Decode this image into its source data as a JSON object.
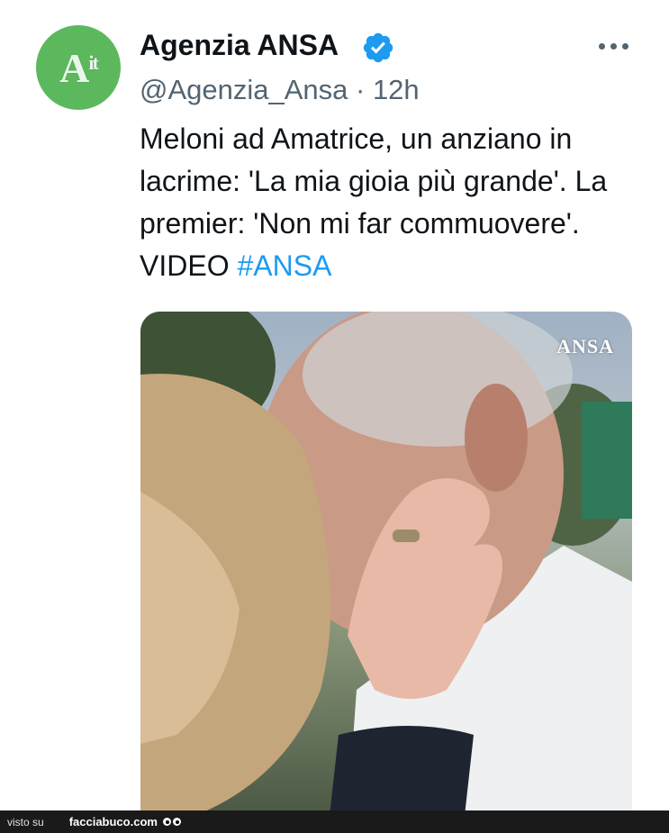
{
  "tweet": {
    "avatar": {
      "icon": "ansa-it-logo",
      "text": "A",
      "sub": "it",
      "color": "#5cb85c"
    },
    "author_name": "Agenzia ANSA",
    "verified_icon": "verified-badge-icon",
    "handle_time": "@Agenzia_Ansa · 12h",
    "text_plain": "Meloni ad Amatrice, un anziano in lacrime: 'La mia gioia più grande'. La premier: 'Non mi far commuovere'. VIDEO ",
    "hashtag": "#ANSA",
    "hashtag_color": "#1d9bf0",
    "more_icon": "more-options-icon",
    "media": {
      "watermark": "ANSA"
    }
  },
  "footer": {
    "prefix": "visto su",
    "site": "facciabuco.com"
  }
}
